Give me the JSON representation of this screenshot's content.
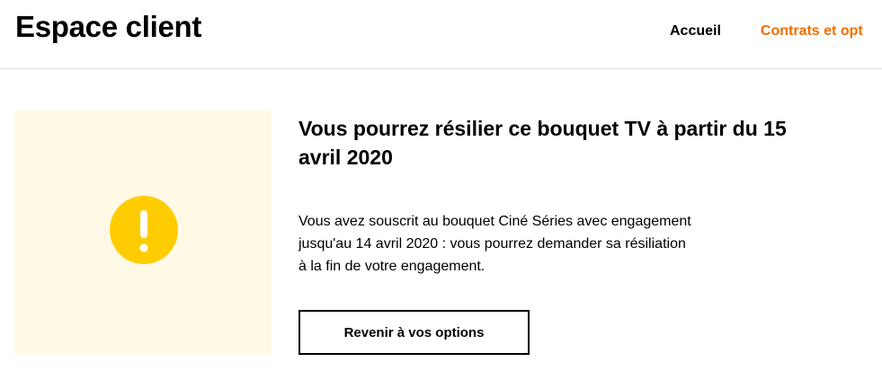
{
  "header": {
    "title": "Espace client",
    "nav": [
      {
        "label": "Accueil",
        "active": false
      },
      {
        "label": "Contrats et opt",
        "active": true
      }
    ]
  },
  "illustration": {
    "icon": "warning-exclamation-icon",
    "background_color": "#fff9e6",
    "icon_color": "#ffcc00"
  },
  "main": {
    "headline": "Vous pourrez résilier ce bouquet TV à partir du 15 avril 2020",
    "description_lines": [
      "Vous avez souscrit au bouquet Ciné Séries avec engagement",
      "jusqu'au 14 avril 2020 : vous pourrez demander sa résiliation",
      "à la fin de votre engagement."
    ],
    "back_button_label": "Revenir à vos options"
  },
  "colors": {
    "accent": "#f16e00",
    "warning": "#ffcc00"
  }
}
